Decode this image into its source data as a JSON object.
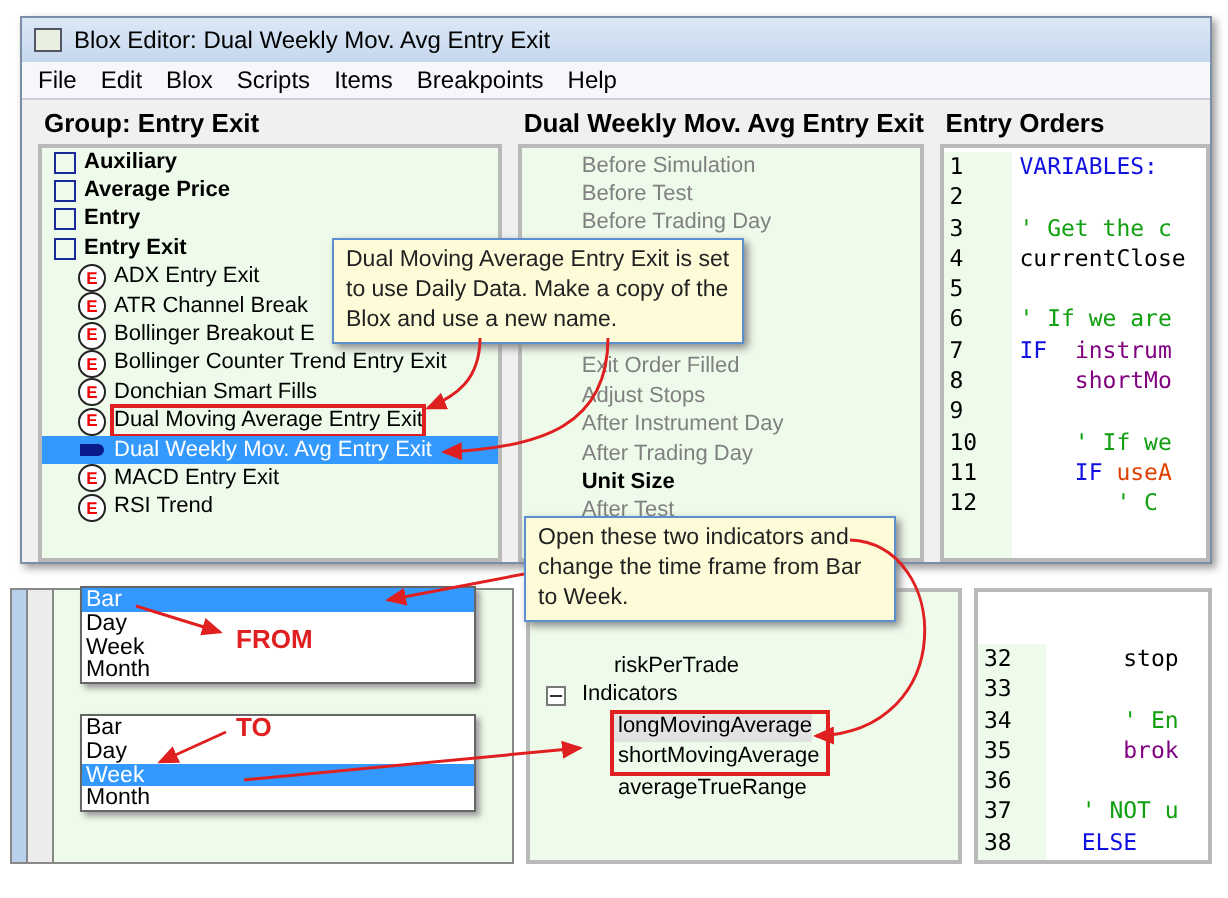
{
  "window": {
    "title": "Blox Editor: Dual Weekly Mov. Avg Entry Exit"
  },
  "menu": [
    "File",
    "Edit",
    "Blox",
    "Scripts",
    "Items",
    "Breakpoints",
    "Help"
  ],
  "group_panel": {
    "heading": "Group: Entry Exit",
    "items": [
      {
        "kind": "group",
        "label": "Auxiliary",
        "selected": false,
        "highlighted": false
      },
      {
        "kind": "group",
        "label": "Average Price",
        "selected": false,
        "highlighted": false
      },
      {
        "kind": "group",
        "label": "Entry",
        "selected": false,
        "highlighted": false
      },
      {
        "kind": "group",
        "label": "Entry Exit",
        "selected": false,
        "highlighted": false
      },
      {
        "kind": "blox",
        "badge": "E",
        "label": "ADX Entry Exit",
        "selected": false,
        "highlighted": false
      },
      {
        "kind": "blox",
        "badge": "E",
        "label": "ATR Channel Break",
        "selected": false,
        "highlighted": false
      },
      {
        "kind": "blox",
        "badge": "E",
        "label": "Bollinger Breakout E",
        "selected": false,
        "highlighted": false
      },
      {
        "kind": "blox",
        "badge": "E",
        "label": "Bollinger Counter Trend Entry Exit",
        "selected": false,
        "highlighted": false
      },
      {
        "kind": "blox",
        "badge": "E",
        "label": "Donchian Smart Fills",
        "selected": false,
        "highlighted": false
      },
      {
        "kind": "blox",
        "badge": "E",
        "label": "Dual Moving Average Entry Exit",
        "selected": false,
        "highlighted": true
      },
      {
        "kind": "blox",
        "label": "Dual Weekly Mov. Avg Entry Exit",
        "selected": true,
        "highlighted": false
      },
      {
        "kind": "blox",
        "badge": "E",
        "label": "MACD Entry Exit",
        "selected": false,
        "highlighted": false
      },
      {
        "kind": "blox",
        "badge": "E",
        "label": "RSI Trend",
        "selected": false,
        "highlighted": false
      }
    ]
  },
  "script_panel": {
    "heading": "Dual Weekly Mov. Avg Entry Exit",
    "items_above": [
      {
        "label": "Before Simulation",
        "has_code": false
      },
      {
        "label": "Before Test",
        "has_code": false
      },
      {
        "label": "Before Trading Day",
        "has_code": false
      }
    ],
    "items_below": [
      {
        "label": "Exit Order Filled",
        "has_code": false
      },
      {
        "label": "Adjust Stops",
        "has_code": false
      },
      {
        "label": "After Instrument Day",
        "has_code": false
      },
      {
        "label": "After Trading Day",
        "has_code": false
      },
      {
        "label": "Unit Size",
        "has_code": true
      },
      {
        "label": "After Test",
        "has_code": false
      }
    ]
  },
  "code_panel": {
    "heading": "Entry Orders",
    "lines": [
      {
        "number": "1",
        "segments": [
          {
            "kind": "keyword",
            "text": "VARIABLES:"
          }
        ]
      },
      {
        "number": "2"
      },
      {
        "number": "3",
        "segments": [
          {
            "kind": "comment",
            "text": "' Get the c"
          }
        ]
      },
      {
        "number": "4",
        "segments": [
          {
            "kind": "plain",
            "text": "currentClose"
          }
        ]
      },
      {
        "number": "5"
      },
      {
        "number": "6",
        "segments": [
          {
            "kind": "comment",
            "text": "' If we are"
          }
        ]
      },
      {
        "number": "7",
        "segments": [
          {
            "kind": "keyword",
            "text": "IF  "
          },
          {
            "kind": "variable",
            "text": "instrum"
          }
        ]
      },
      {
        "number": "8",
        "segments": [
          {
            "kind": "variable",
            "text": "    shortMo"
          }
        ]
      },
      {
        "number": "9"
      },
      {
        "number": "10",
        "segments": [
          {
            "kind": "comment",
            "text": "    ' If we"
          }
        ]
      },
      {
        "number": "11",
        "segments": [
          {
            "kind": "keyword",
            "text": "    IF "
          },
          {
            "kind": "parameter",
            "text": "useA"
          }
        ]
      },
      {
        "number": "12",
        "segments": [
          {
            "kind": "comment",
            "text": "       ' C"
          }
        ]
      }
    ]
  },
  "lower_tree": {
    "items": [
      {
        "label": "riskPerTrade"
      },
      {
        "label": "Indicators",
        "expanded": true,
        "children": [
          {
            "label": "longMovingAverage",
            "selected": true,
            "highlighted": true
          },
          {
            "label": "shortMovingAverage",
            "selected": false,
            "highlighted": true
          },
          {
            "label": "averageTrueRange",
            "selected": false,
            "highlighted": false
          }
        ]
      }
    ]
  },
  "lower_code": {
    "lines": [
      {
        "number": "32",
        "segments": [
          {
            "kind": "plain",
            "text": "     stop"
          }
        ]
      },
      {
        "number": "33"
      },
      {
        "number": "34",
        "segments": [
          {
            "kind": "comment",
            "text": "     ' En"
          }
        ]
      },
      {
        "number": "35",
        "segments": [
          {
            "kind": "variable",
            "text": "     brok"
          }
        ]
      },
      {
        "number": "36"
      },
      {
        "number": "37",
        "segments": [
          {
            "kind": "comment",
            "text": "  ' NOT u"
          }
        ]
      },
      {
        "number": "38",
        "segments": [
          {
            "kind": "keyword",
            "text": "  ELSE"
          }
        ]
      }
    ]
  },
  "timeframe_lists": [
    {
      "note": "FROM",
      "options": [
        {
          "label": "Bar",
          "selected": true
        },
        {
          "label": "Day",
          "selected": false
        },
        {
          "label": "Week",
          "selected": false
        },
        {
          "label": "Month",
          "selected": false
        }
      ]
    },
    {
      "note": "TO",
      "options": [
        {
          "label": "Bar",
          "selected": false
        },
        {
          "label": "Day",
          "selected": false
        },
        {
          "label": "Week",
          "selected": true
        },
        {
          "label": "Month",
          "selected": false
        }
      ]
    }
  ],
  "callouts": [
    {
      "text": "Dual Moving Average Entry Exit is set to use Daily Data.  Make a copy of the Blox and use a new name."
    },
    {
      "text": "Open these two indicators and change the time frame from Bar to Week."
    }
  ]
}
